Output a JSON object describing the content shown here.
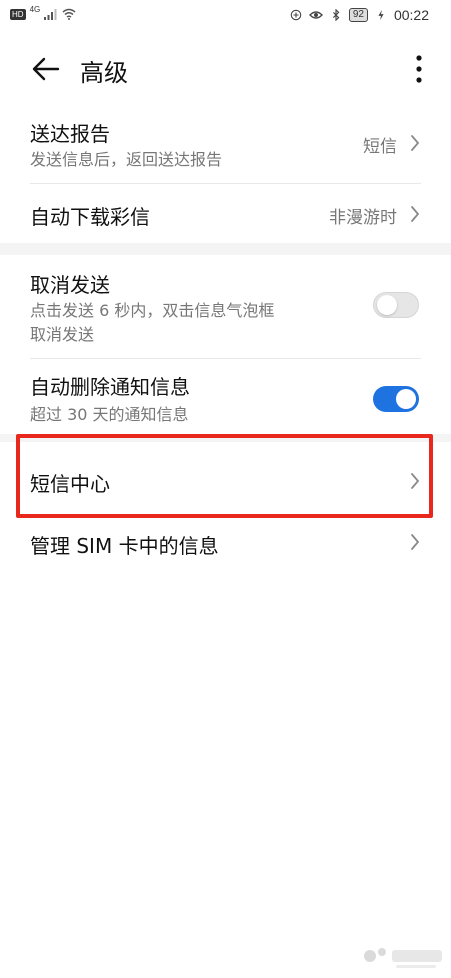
{
  "status_bar": {
    "hd": "HD",
    "network": "4G",
    "battery": "92",
    "time": "00:22"
  },
  "app_bar": {
    "title": "高级"
  },
  "settings": {
    "delivery_report": {
      "title": "送达报告",
      "subtitle": "发送信息后，返回送达报告",
      "value": "短信"
    },
    "auto_download_mms": {
      "title": "自动下载彩信",
      "value": "非漫游时"
    },
    "cancel_send": {
      "title": "取消发送",
      "subtitle_line1": "点击发送 6 秒内，双击信息气泡框",
      "subtitle_line2": "取消发送",
      "enabled": false
    },
    "auto_delete_notifications": {
      "title": "自动删除通知信息",
      "subtitle": "超过 30 天的通知信息",
      "enabled": true
    },
    "sms_center": {
      "title": "短信中心"
    },
    "manage_sim_messages": {
      "title": "管理 SIM 卡中的信息"
    }
  },
  "colors": {
    "accent": "#1f73e0",
    "highlight_border": "#e8281d",
    "secondary_text": "#777777"
  },
  "icons": {
    "back": "back-arrow-icon",
    "more": "more-vert-icon",
    "chevron": "chevron-right-icon"
  }
}
